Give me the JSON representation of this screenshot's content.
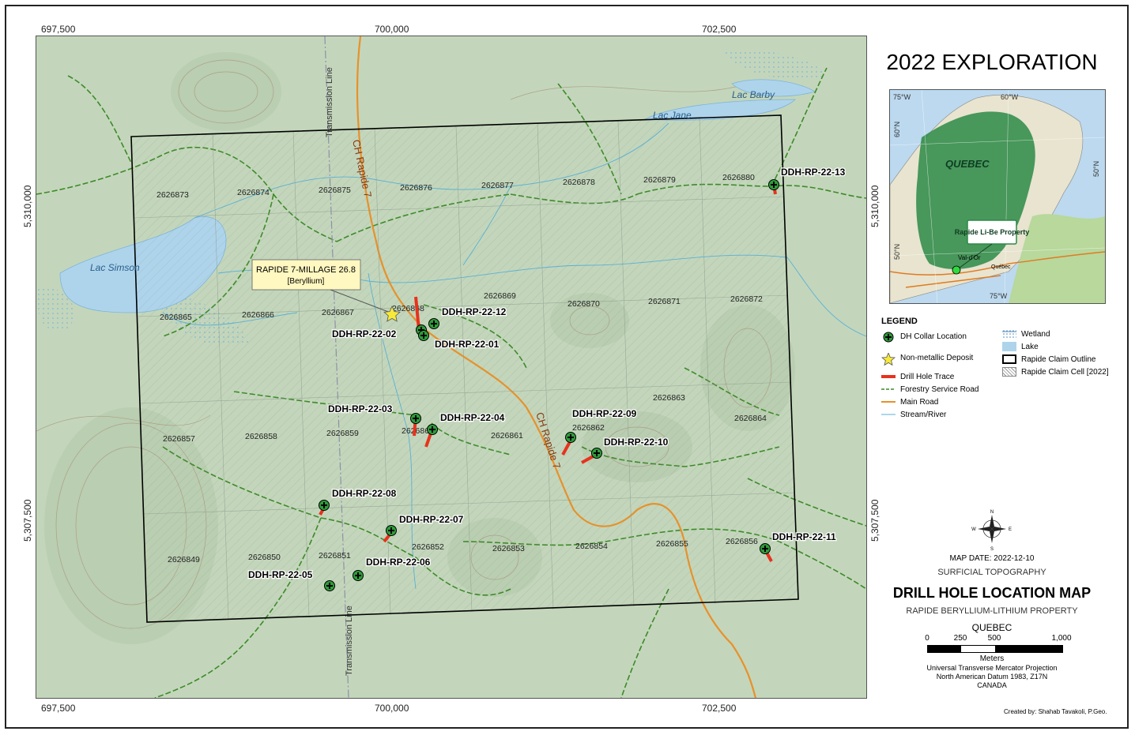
{
  "coords": {
    "x_ticks": [
      "697,500",
      "700,000",
      "702,500"
    ],
    "y_ticks": [
      "5,310,000",
      "5,307,500"
    ]
  },
  "map": {
    "claim_cells": [
      "2626873",
      "2626874",
      "2626875",
      "2626876",
      "2626877",
      "2626878",
      "2626879",
      "2626880",
      "2626865",
      "2626866",
      "2626867",
      "2626868",
      "2626869",
      "2626870",
      "2626871",
      "2626872",
      "2626857",
      "2626858",
      "2626859",
      "2626860",
      "2626861",
      "2626862",
      "2626863",
      "2626864",
      "2626849",
      "2626850",
      "2626851",
      "2626852",
      "2626853",
      "2626854",
      "2626855",
      "2626856"
    ],
    "drill_holes": [
      "DDH-RP-22-13",
      "DDH-RP-22-12",
      "DDH-RP-22-02",
      "DDH-RP-22-01",
      "DDH-RP-22-03",
      "DDH-RP-22-04",
      "DDH-RP-22-09",
      "DDH-RP-22-10",
      "DDH-RP-22-08",
      "DDH-RP-22-07",
      "DDH-RP-22-11",
      "DDH-RP-22-06",
      "DDH-RP-22-05"
    ],
    "lakes": [
      "Lac Simson",
      "Lac Jane",
      "Lac Barby"
    ],
    "roads": [
      "CH Rapide 7",
      "CH Rapide 7"
    ],
    "lines": [
      "Transmission Line",
      "Transmission Line"
    ],
    "deposit_callout": {
      "name": "RAPIDE 7-MILLAGE 26.8",
      "type": "[Beryllium]"
    }
  },
  "panel": {
    "title": "2022 EXPLORATION",
    "inset": {
      "province": "QUEBEC",
      "property_label": "Rapide Li-Be Property",
      "towns": [
        "Val-d'Or",
        "Québec"
      ],
      "graticule": [
        "75°W",
        "60°W",
        "60°N",
        "50°N",
        "50°N",
        "75°W"
      ]
    },
    "legend": {
      "title": "LEGEND",
      "left": [
        "DH Collar Location",
        "Non-metallic Deposit",
        "Drill Hole Trace",
        "Forestry Service Road",
        "Main Road",
        "Stream/River"
      ],
      "right": [
        "Wetland",
        "Lake",
        "Rapide Claim Outline",
        "Rapide Claim Cell [2022]"
      ]
    },
    "compass": {
      "n": "N",
      "s": "S",
      "e": "E",
      "w": "W"
    },
    "map_date": "MAP DATE: 2022-12-10",
    "subtitle": "SURFICIAL TOPOGRAPHY",
    "main_title": "DRILL HOLE LOCATION MAP",
    "property": "RAPIDE BERYLLIUM-LITHIUM PROPERTY",
    "province": "QUEBEC",
    "scale_labels": [
      "0",
      "250",
      "500",
      "1,000"
    ],
    "scale_unit": "Meters",
    "projection": [
      "Universal Transverse Mercator Projection",
      "North American Datum 1983, Z17N",
      "CANADA"
    ],
    "credit": "Created by: Shahab Tavakoli, P.Geo."
  },
  "colors": {
    "terrain": "#c3d6bb",
    "lake": "#aed4ec",
    "collar": "#2e9c3a",
    "trace": "#e8321e",
    "forestry_road": "#3d8a28",
    "main_road": "#e8912a",
    "stream": "#5ab0d6",
    "claim": "#000000"
  }
}
